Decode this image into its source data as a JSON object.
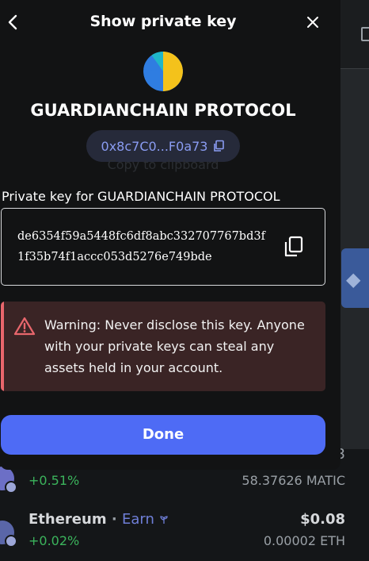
{
  "modal": {
    "title": "Show private key",
    "account_name": "GUARDIANCHAIN PROTOCOL",
    "address_short": "0x8c7C0...F0a73",
    "copy_tooltip": "Copy to clipboard",
    "private_key_label": "Private key for GUARDIANCHAIN PROTOCOL",
    "private_key": "de6354f59a5448fc6df8abc332707767bd3f1f35b74f1accc053d5276e749bde",
    "warning_text": "Warning: Never disclose this key. Anyone with your private keys can steal any assets held in your account.",
    "done_label": "Done"
  },
  "background": {
    "assets": [
      {
        "partial_value": "3",
        "change": "+0.51%",
        "amount": "58.37626 MATIC"
      },
      {
        "name": "Ethereum",
        "separator": "·",
        "earn_label": "Earn",
        "value": "$0.08",
        "change": "+0.02%",
        "amount": "0.00002 ETH"
      }
    ]
  },
  "colors": {
    "accent": "#4e6bf5",
    "address_text": "#8a9cf2",
    "warning_bar": "#e8666c",
    "warning_bg": "#3a2425",
    "positive": "#3bb45c"
  },
  "icons": {
    "back": "chevron-left-icon",
    "close": "close-icon",
    "copy": "copy-icon",
    "warning": "warning-triangle-icon"
  }
}
